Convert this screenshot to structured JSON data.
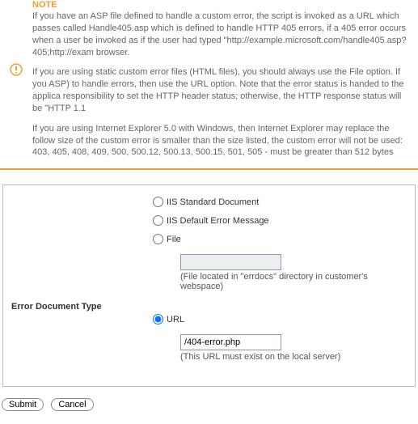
{
  "note": {
    "title": "NOTE",
    "p1": "If you have an ASP file defined to handle a custom error, the script is invoked as a URL which passes called Handle405.asp which is defined to handle HTTP 405 errors, if a 405 error occurs when a user be invoked as if the user had typed \"http://example.microsoft.com/handle405.asp?405;http://exam browser.",
    "p2": "If you are using static custom error files (HTML files), you should always use the File option. If you ASP) to handle errors, then use the URL option. Note that the error status is handed to the applica responsibility to set the HTTP header status; otherwise, the HTTP response status will be \"HTTP 1.1",
    "p3": "If you are using Internet Explorer 5.0 with Windows, then Internet Explorer may replace the follow size of the custom error is smaller than the size listed, the custom error will not be used: 403, 405, 408, 409, 500, 500.12, 500.13, 500.15, 501, 505 - must be greater than 512 bytes"
  },
  "form": {
    "section_label": "Error Document Type",
    "options": {
      "iis_std": "IIS Standard Document",
      "iis_default": "IIS Default Error Message",
      "file": "File",
      "url": "URL"
    },
    "file_value": "",
    "file_hint": "(File located in \"errdocs\" directory in customer's webspace)",
    "url_value": "/404-error.php",
    "url_hint": "(This URL must exist on the local server)",
    "selected": "url"
  },
  "buttons": {
    "submit": "Submit",
    "cancel": "Cancel"
  },
  "icons": {
    "warning": "warning-icon"
  }
}
